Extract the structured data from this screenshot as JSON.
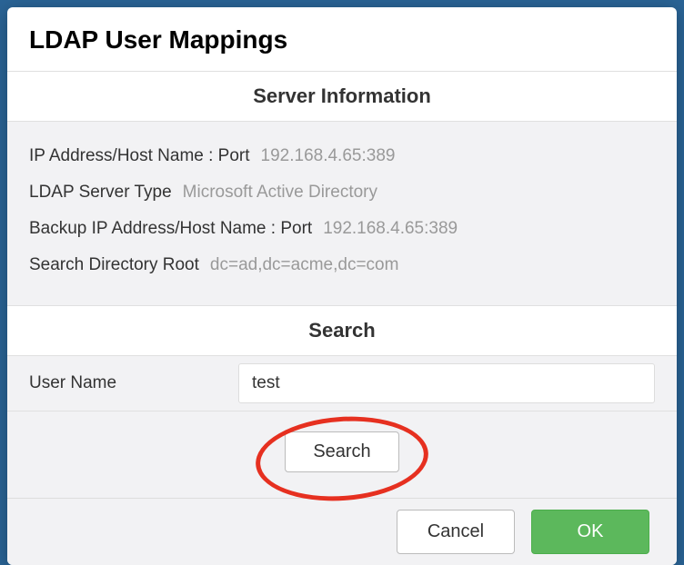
{
  "modal": {
    "title": "LDAP User Mappings"
  },
  "server_info": {
    "section_title": "Server Information",
    "ip_label": "IP Address/Host Name : Port",
    "ip_value": "192.168.4.65:389",
    "type_label": "LDAP Server Type",
    "type_value": "Microsoft Active Directory",
    "backup_label": "Backup IP Address/Host Name : Port",
    "backup_value": "192.168.4.65:389",
    "root_label": "Search Directory Root",
    "root_value": "dc=ad,dc=acme,dc=com"
  },
  "search": {
    "section_title": "Search",
    "username_label": "User Name",
    "username_value": "test",
    "search_button": "Search"
  },
  "footer": {
    "cancel": "Cancel",
    "ok": "OK"
  },
  "highlight": {
    "color": "#e63020"
  }
}
